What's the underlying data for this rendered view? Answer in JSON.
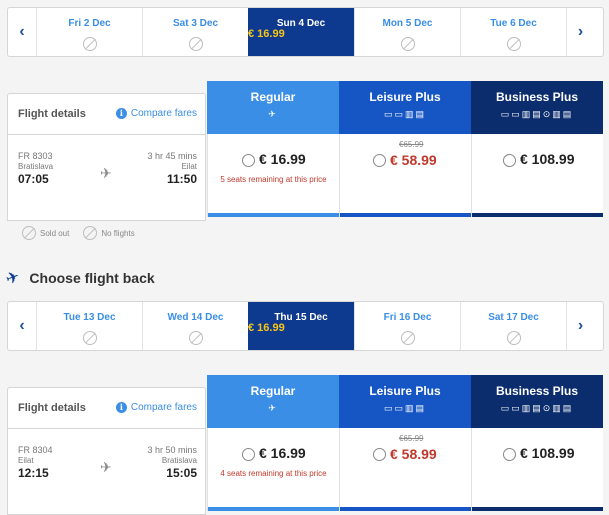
{
  "outbound": {
    "dates": [
      {
        "label": "Fri 2 Dec",
        "price": "",
        "selected": false
      },
      {
        "label": "Sat 3 Dec",
        "price": "",
        "selected": false
      },
      {
        "label": "Sun 4 Dec",
        "price": "€ 16.99",
        "selected": true
      },
      {
        "label": "Mon 5 Dec",
        "price": "",
        "selected": false
      },
      {
        "label": "Tue 6 Dec",
        "price": "",
        "selected": false
      }
    ],
    "details_title": "Flight details",
    "compare_label": "Compare fares",
    "flight": {
      "number": "FR 8303",
      "from": "Bratislava",
      "dep": "07:05",
      "duration": "3 hr 45 mins",
      "to": "Eilat",
      "arr": "11:50"
    },
    "fares": {
      "regular": {
        "name": "Regular",
        "price": "€ 16.99",
        "seats": "5 seats remaining at this price"
      },
      "leisure": {
        "name": "Leisure Plus",
        "old": "€65.99",
        "price": "€ 58.99"
      },
      "business": {
        "name": "Business Plus",
        "price": "€ 108.99"
      }
    }
  },
  "legend": {
    "sold_out": "Sold out",
    "no_flights": "No flights"
  },
  "back_heading": "Choose flight back",
  "inbound": {
    "dates": [
      {
        "label": "Tue 13 Dec",
        "price": "",
        "selected": false
      },
      {
        "label": "Wed 14 Dec",
        "price": "",
        "selected": false
      },
      {
        "label": "Thu 15 Dec",
        "price": "€ 16.99",
        "selected": true
      },
      {
        "label": "Fri 16 Dec",
        "price": "",
        "selected": false
      },
      {
        "label": "Sat 17 Dec",
        "price": "",
        "selected": false
      }
    ],
    "details_title": "Flight details",
    "compare_label": "Compare fares",
    "flight": {
      "number": "FR 8304",
      "from": "Eilat",
      "dep": "12:15",
      "duration": "3 hr 50 mins",
      "to": "Bratislava",
      "arr": "15:05"
    },
    "fares": {
      "regular": {
        "name": "Regular",
        "price": "€ 16.99",
        "seats": "4 seats remaining at this price"
      },
      "leisure": {
        "name": "Leisure Plus",
        "old": "€65.99",
        "price": "€ 58.99"
      },
      "business": {
        "name": "Business Plus",
        "price": "€ 108.99"
      }
    }
  },
  "colors": {
    "regular": "#3a8ee6",
    "leisure": "#1655c4",
    "business": "#0b2d6e",
    "selected_date": "#0d3a8f",
    "price_yellow": "#f5c518",
    "sale_red": "#c0392b"
  },
  "icons": {
    "nav_prev": "chevron-left-icon",
    "nav_next": "chevron-right-icon",
    "no_flight": "no-flight-icon",
    "plane": "plane-icon",
    "info": "info-icon"
  }
}
